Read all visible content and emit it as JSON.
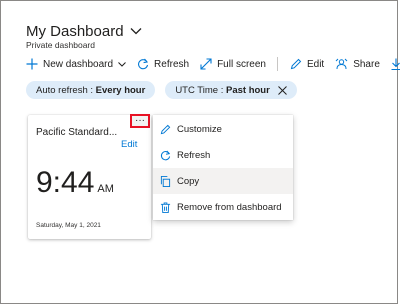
{
  "header": {
    "title": "My Dashboard",
    "subtitle": "Private dashboard"
  },
  "toolbar": {
    "new_dashboard": "New dashboard",
    "refresh": "Refresh",
    "full_screen": "Full screen",
    "edit": "Edit",
    "share": "Share"
  },
  "filters": {
    "auto_refresh_label": "Auto refresh : ",
    "auto_refresh_value": "Every hour",
    "utc_time_label": "UTC Time : ",
    "utc_time_value": "Past hour"
  },
  "tile": {
    "title": "Pacific Standard...",
    "edit": "Edit",
    "time": "9:44",
    "ampm": "AM",
    "date": "Saturday, May 1, 2021",
    "more": "···"
  },
  "context_menu": {
    "items": [
      {
        "label": "Customize",
        "icon": "pencil-icon"
      },
      {
        "label": "Refresh",
        "icon": "refresh-icon"
      },
      {
        "label": "Copy",
        "icon": "copy-icon"
      },
      {
        "label": "Remove from dashboard",
        "icon": "trash-icon"
      }
    ]
  },
  "colors": {
    "accent": "#0078d4",
    "pill_bg": "#deecf9",
    "highlight_border": "#e81123",
    "hover_bg": "#f3f2f1"
  }
}
